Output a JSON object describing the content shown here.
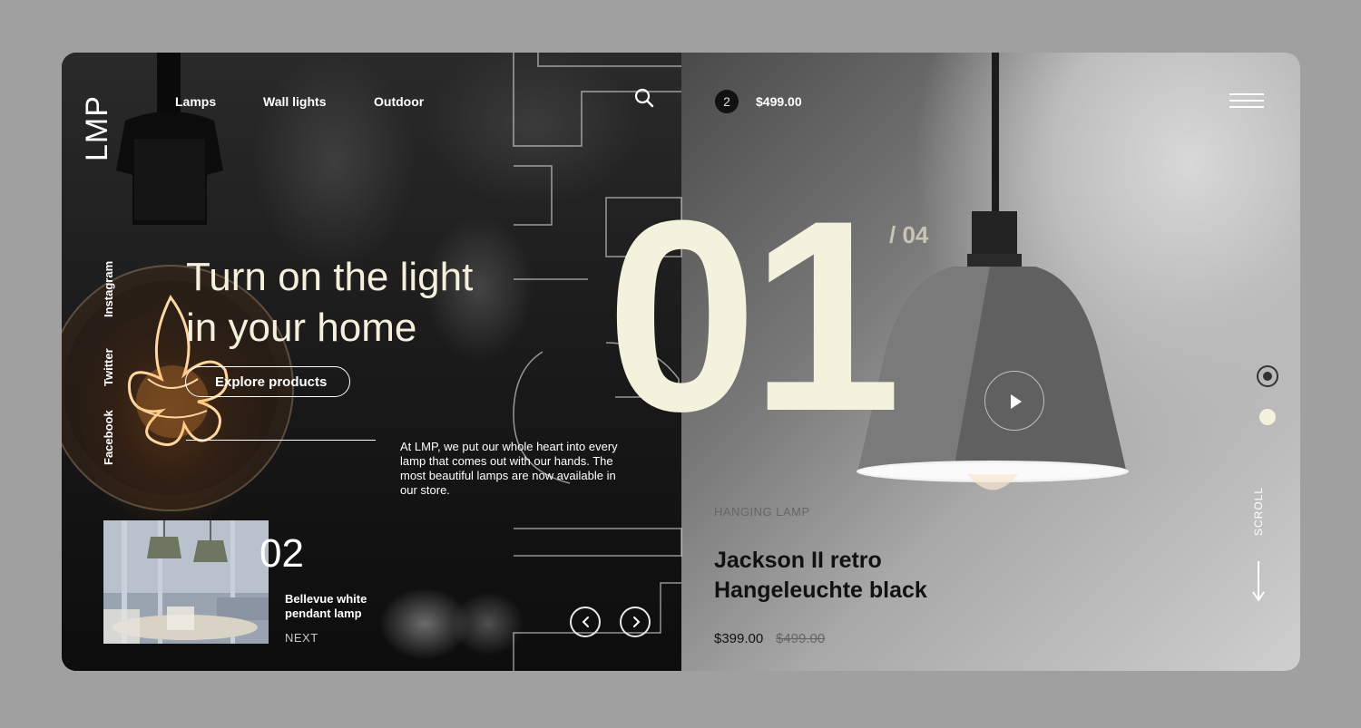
{
  "brand": {
    "logo": "LMP"
  },
  "nav": {
    "lamps": "Lamps",
    "wall_lights": "Wall lights",
    "outdoor": "Outdoor"
  },
  "social": {
    "instagram": "Instagram",
    "twitter": "Twitter",
    "facebook": "Facebook"
  },
  "hero": {
    "headline_line1": "Turn on the light",
    "headline_line2": "in your home",
    "cta": "Explore products",
    "description": "At LMP, we put our whole heart into every lamp that comes out with our hands. The most beautiful lamps are now available in our store."
  },
  "next_product": {
    "number": "02",
    "title": "Bellevue white pendant lamp",
    "label": "NEXT"
  },
  "slider": {
    "current": "01",
    "total": "/ 04"
  },
  "cart": {
    "count": "2",
    "total": "$499.00"
  },
  "product": {
    "category": "HANGING LAMP",
    "title": "Jackson II retro Hangeleuchte black",
    "price": "$399.00",
    "old_price": "$499.00"
  },
  "scroll": {
    "label": "SCROLL"
  },
  "colors": {
    "accent": "#f3f2dc",
    "dark": "#1a1a1a"
  },
  "icons": [
    "search-icon",
    "play-icon",
    "chevron-left-icon",
    "chevron-right-icon",
    "hamburger-menu-icon",
    "arrow-down-icon"
  ]
}
